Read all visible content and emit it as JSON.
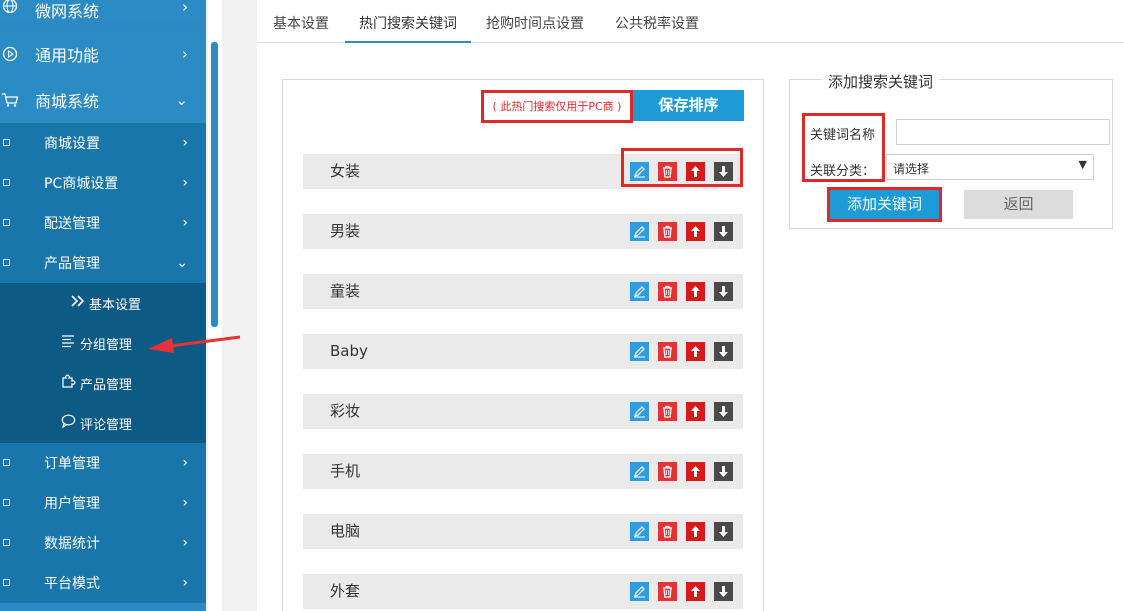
{
  "sidebar": {
    "top_items": [
      {
        "label": "微网系统",
        "icon": "globe-icon",
        "arrow": "›"
      },
      {
        "label": "通用功能",
        "icon": "play-circle-icon",
        "arrow": "›"
      },
      {
        "label": "商城系统",
        "icon": "cart-icon",
        "arrow": "⌄"
      }
    ],
    "sub_items": [
      {
        "label": "商城设置",
        "arrow": "›"
      },
      {
        "label": "PC商城设置",
        "arrow": "›"
      },
      {
        "label": "配送管理",
        "arrow": "›"
      },
      {
        "label": "产品管理",
        "arrow": "⌄"
      }
    ],
    "leaf_items": [
      {
        "label": "基本设置",
        "icon": "double-chevron-icon"
      },
      {
        "label": "分组管理",
        "icon": "list-icon"
      },
      {
        "label": "产品管理",
        "icon": "puzzle-icon"
      },
      {
        "label": "评论管理",
        "icon": "comment-icon"
      }
    ],
    "bottom_items": [
      {
        "label": "订单管理",
        "arrow": "›"
      },
      {
        "label": "用户管理",
        "arrow": "›"
      },
      {
        "label": "数据统计",
        "arrow": "›"
      },
      {
        "label": "平台模式",
        "arrow": "›"
      }
    ]
  },
  "tabs": [
    {
      "label": "基本设置",
      "active": false
    },
    {
      "label": "热门搜索关键词",
      "active": true
    },
    {
      "label": "抢购时间点设置",
      "active": false
    },
    {
      "label": "公共税率设置",
      "active": false
    }
  ],
  "keywords": {
    "notice": "( 此热门搜索仅用于PC商 )",
    "save_label": "保存排序",
    "items": [
      "女装",
      "男装",
      "童装",
      "Baby",
      "彩妆",
      "手机",
      "电脑",
      "外套"
    ]
  },
  "form": {
    "legend": "添加搜索关键词",
    "name_label": "关键词名称",
    "name_value": "",
    "category_label": "关联分类：",
    "category_value": "请选择",
    "add_label": "添加关键词",
    "back_label": "返回"
  },
  "colors": {
    "sidebar": "#2a8bc5",
    "sidebar_sub": "#1976ab",
    "sidebar_leaf": "#0d5a85",
    "primary_button": "#1c9bd7",
    "highlight": "#e0282a"
  }
}
